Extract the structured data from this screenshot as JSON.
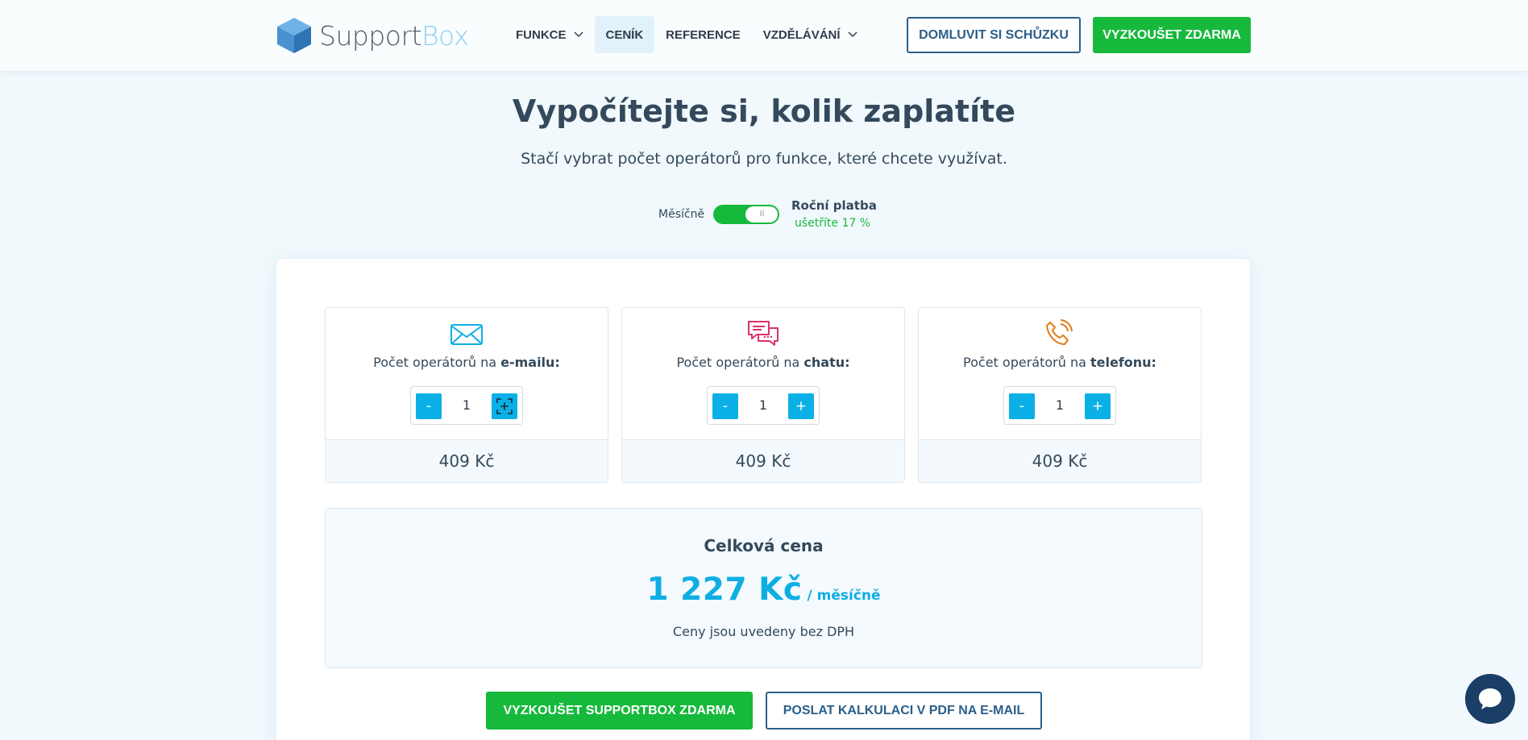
{
  "header": {
    "logo": {
      "support": "Support",
      "box": "Box"
    },
    "nav": [
      {
        "label": "FUNKCE"
      },
      {
        "label": "CENÍK"
      },
      {
        "label": "REFERENCE"
      },
      {
        "label": "VZDĚLÁVÁNÍ"
      }
    ],
    "cta_meeting": "DOMLUVIT SI SCHŮZKU",
    "cta_trial": "VYZKOUŠET ZDARMA"
  },
  "hero": {
    "title": "Vypočítejte si, kolik zaplatíte",
    "subtitle": "Stačí vybrat počet operátorů pro funkce, které chcete využívat."
  },
  "billing": {
    "monthly_label": "Měsíčně",
    "yearly_label": "Roční platba",
    "yearly_savings": "ušetříte 17 %",
    "toggle_knob": "III",
    "selected": "monthly"
  },
  "calculator": {
    "operators": [
      {
        "label_prefix": "Počet operátorů na ",
        "channel": "e-mailu:",
        "icon": "envelope-icon",
        "icon_color": "#0eaee3",
        "minus": "-",
        "plus": "+",
        "value": "1",
        "price": "409 Kč"
      },
      {
        "label_prefix": "Počet operátorů na ",
        "channel": "chatu:",
        "icon": "chat-bubbles-icon",
        "icon_color": "#d6336c",
        "minus": "-",
        "plus": "+",
        "value": "1",
        "price": "409 Kč"
      },
      {
        "label_prefix": "Počet operátorů na ",
        "channel": "telefonu:",
        "icon": "phone-icon",
        "icon_color": "#e07a1a",
        "minus": "-",
        "plus": "+",
        "value": "1",
        "price": "409 Kč"
      }
    ],
    "total": {
      "title": "Celková cena",
      "value": "1 227 Kč",
      "period": "/ měsíčně",
      "note": "Ceny jsou uvedeny bez DPH"
    },
    "btn_try": "VYZKOUŠET SUPPORTBOX ZDARMA",
    "btn_pdf": "POSLAT KALKULACI V PDF NA E-MAIL"
  },
  "colors": {
    "accent_blue": "#0eaee3",
    "green": "#16b93c",
    "navy": "#2b5f8a",
    "chat_widget": "#1a3e66"
  }
}
